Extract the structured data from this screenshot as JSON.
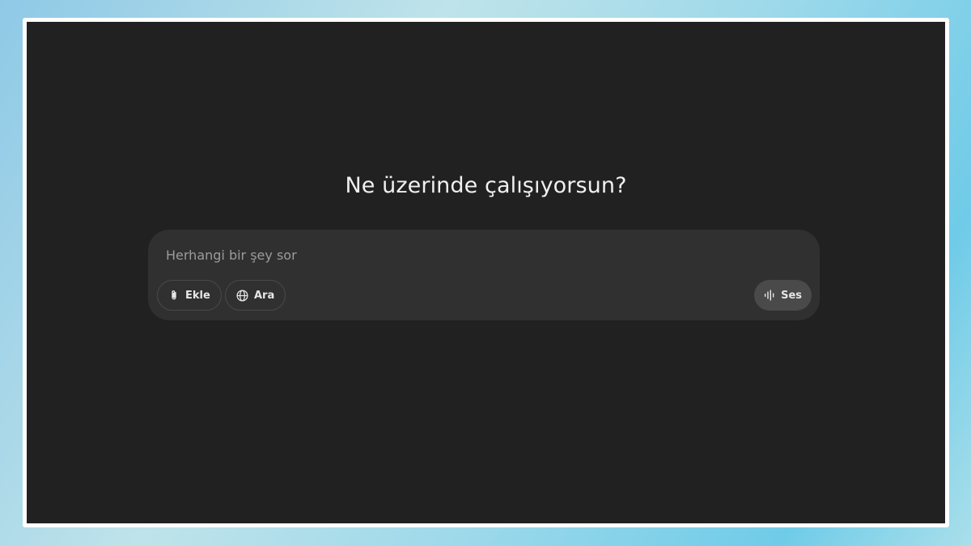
{
  "main": {
    "headline": "Ne üzerinde çalışıyorsun?"
  },
  "composer": {
    "placeholder": "Herhangi bir şey sor",
    "value": "",
    "buttons": {
      "attach_label": "Ekle",
      "search_label": "Ara",
      "voice_label": "Ses"
    },
    "icons": {
      "attach": "paperclip-icon",
      "search": "globe-icon",
      "voice": "voice-waveform-icon"
    }
  },
  "colors": {
    "background": "#212121",
    "composer": "#303030",
    "text": "#f0f0f0",
    "placeholder": "#9b9b9b",
    "voice_button": "#4a4a4a"
  }
}
